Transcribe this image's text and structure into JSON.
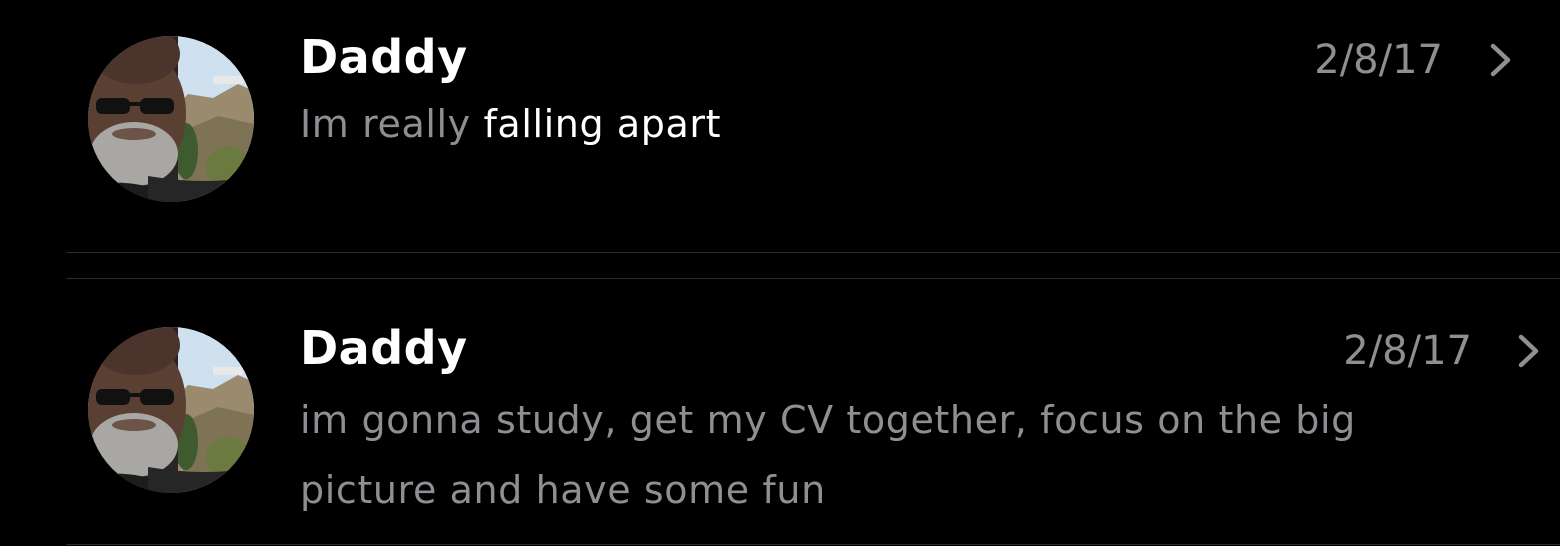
{
  "conversations": [
    {
      "contact_name": "Daddy",
      "date": "2/8/17",
      "preview_plain": "Im really ",
      "preview_highlight": "falling apart",
      "avatar_icon": "contact-photo",
      "chevron_icon": "chevron-right-icon"
    },
    {
      "contact_name": "Daddy",
      "date": "2/8/17",
      "preview_plain": "im gonna study, get my CV together, focus on the big picture and have some fun",
      "avatar_icon": "contact-photo",
      "chevron_icon": "chevron-right-icon"
    }
  ],
  "colors": {
    "background": "#000000",
    "name": "#ffffff",
    "secondary_text": "#8e8e93",
    "highlight_text": "#ffffff",
    "separator": "#2c2c2e"
  }
}
